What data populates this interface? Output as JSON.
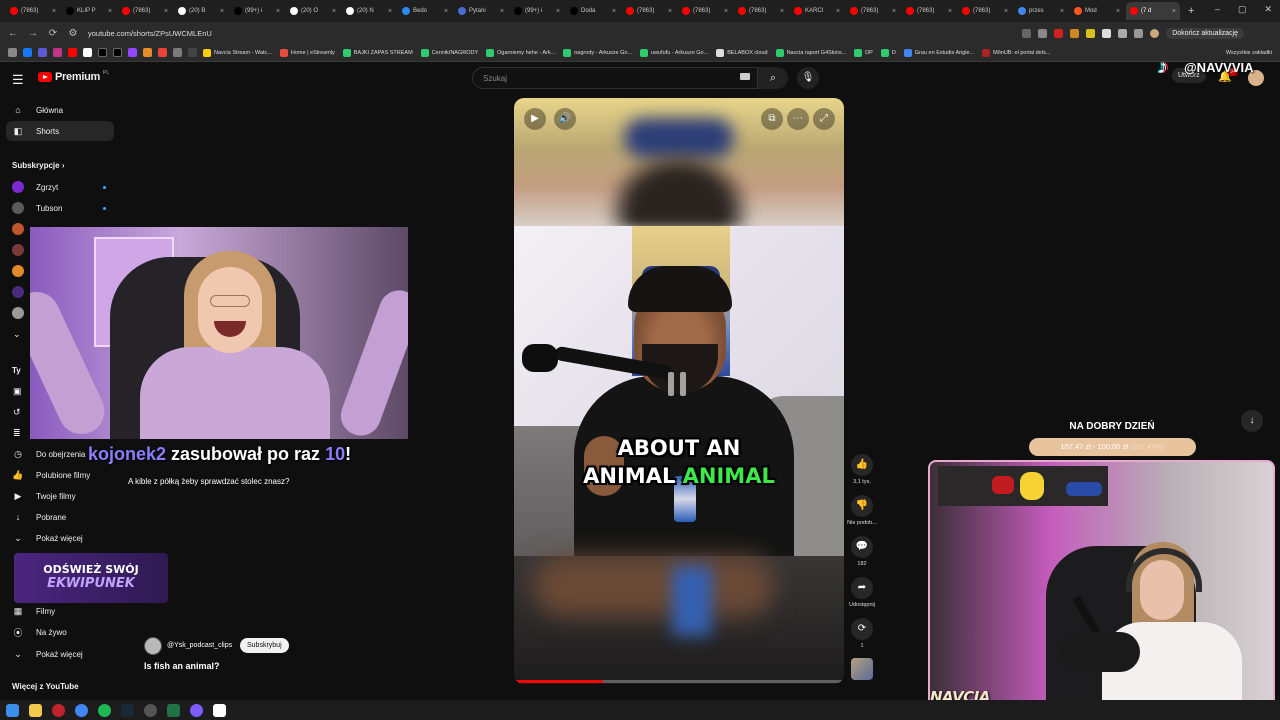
{
  "browser": {
    "tabs": [
      {
        "label": "(7863)",
        "color": "#ff0000",
        "active": false
      },
      {
        "label": "KLIP P",
        "color": "#000000",
        "active": false
      },
      {
        "label": "(7863)",
        "color": "#ff0000",
        "active": false
      },
      {
        "label": "(20) B",
        "color": "#ffffff",
        "active": false
      },
      {
        "label": "(99+) i",
        "color": "#000000",
        "active": false
      },
      {
        "label": "(20) O",
        "color": "#ffffff",
        "active": false
      },
      {
        "label": "(20) N",
        "color": "#ffffff",
        "active": false
      },
      {
        "label": "Bedo",
        "color": "#2b8cf0",
        "active": false
      },
      {
        "label": "Pytani",
        "color": "#4a6cd4",
        "active": false
      },
      {
        "label": "(99+) i",
        "color": "#000000",
        "active": false
      },
      {
        "label": "Doda",
        "color": "#000000",
        "active": false
      },
      {
        "label": "(7863)",
        "color": "#ff0000",
        "active": false
      },
      {
        "label": "(7863)",
        "color": "#ff0000",
        "active": false
      },
      {
        "label": "(7863)",
        "color": "#ff0000",
        "active": false
      },
      {
        "label": "KARCI",
        "color": "#ff0000",
        "active": false
      },
      {
        "label": "(7863)",
        "color": "#ff0000",
        "active": false
      },
      {
        "label": "(7863)",
        "color": "#ff0000",
        "active": false
      },
      {
        "label": "(7863)",
        "color": "#ff0000",
        "active": false
      },
      {
        "label": "przes",
        "color": "#4285f4",
        "active": false
      },
      {
        "label": "Mod",
        "color": "#ff5722",
        "active": false
      },
      {
        "label": "(7 d",
        "color": "#ff0000",
        "active": true
      }
    ],
    "new_tab": "+",
    "window_controls": [
      "–",
      "▢",
      "✕"
    ],
    "url": "youtube.com/shorts/ZPsUWCMLEnU",
    "update_button": "Dokończ aktualizację",
    "bookmarks": [
      "Navcia Stream - Watc...",
      "Home | eStreamly",
      "BAJKI ZAPAS STREAM",
      "Cennik/NAGRODY",
      "Ogarniemy hehe - Ark...",
      "nagrody - Arkusze Go...",
      "uwufufu - Arkusze Go...",
      "BELABOX cloud",
      "Navcia raport G4Skins...",
      "DP",
      "D",
      "Grau en Estudis Angle...",
      "MônUB: el portal dels..."
    ],
    "all_bookmarks": "Wszystkie zakładki"
  },
  "youtube": {
    "logo_text": "Premium",
    "country_code": "PL",
    "search_placeholder": "Szukaj",
    "create_label": "Utwórz",
    "bell_badge": "9+",
    "sidebar": {
      "main": [
        {
          "label": "Główna",
          "icon": "⌂"
        },
        {
          "label": "Shorts",
          "icon": "▶"
        }
      ],
      "subscriptions_heading": "Subskrypcje",
      "subs": [
        {
          "label": "Zgrzyt",
          "color": "#7b2ad1"
        },
        {
          "label": "Tubson",
          "color": "#5a5a5a"
        }
      ],
      "you_heading": "Ty",
      "you": [
        {
          "label": "Do obejrzenia",
          "icon": "◷"
        },
        {
          "label": "Polubione filmy",
          "icon": "👍"
        },
        {
          "label": "Twoje filmy",
          "icon": "▶"
        },
        {
          "label": "Pobrane",
          "icon": "↓"
        },
        {
          "label": "Pokaż więcej",
          "icon": "⌄"
        }
      ],
      "explore": [
        {
          "label": "Filmy",
          "icon": "▦"
        },
        {
          "label": "Na żywo",
          "icon": "((•))"
        },
        {
          "label": "Pokaż więcej",
          "icon": "⌄"
        }
      ],
      "more_heading": "Więcej z YouTube"
    },
    "short": {
      "caption_line1": "ABOUT AN",
      "caption_line2_a": "ANIMAL",
      "caption_line2_b": "ANIMAL",
      "progress": 0.27,
      "channel": "@Ysk_podcast_clips",
      "subscribe_label": "Subskrybuj",
      "title": "Is fish an animal?",
      "actions": [
        {
          "name": "like",
          "icon": "👍",
          "label": "3,1 tys."
        },
        {
          "name": "dislike",
          "icon": "👎",
          "label": "Nie podob..."
        },
        {
          "name": "comments",
          "icon": "💬",
          "label": "182"
        },
        {
          "name": "share",
          "icon": "➦",
          "label": "Udostępnij"
        },
        {
          "name": "remix",
          "icon": "⟳",
          "label": "1"
        }
      ]
    }
  },
  "stream": {
    "tiktok_handle": "@NAVVVIA",
    "sub_alert_user": "kojonek2",
    "sub_alert_text": " zasubował po raz ",
    "sub_alert_count": "10",
    "sub_alert_end": "!",
    "sub_alert_message": "A kible z półką żeby sprawdzać stolec znasz?",
    "ekwipunek_line1": "ODŚWIEŻ SWÓJ",
    "ekwipunek_line2": "EKWIPUNEK",
    "goal_title": "NA DOBRY DZIEŃ",
    "goal_amount": "107,47 zł - 100,00 zł",
    "goal_percent_text": "(107,47%)",
    "goal_fraction": 1.0,
    "cam_name": "NAVCIA"
  },
  "colors": {
    "accent_red": "#ff0000",
    "sub_purple": "#8a7dff",
    "caption_green": "#3ce84a"
  }
}
